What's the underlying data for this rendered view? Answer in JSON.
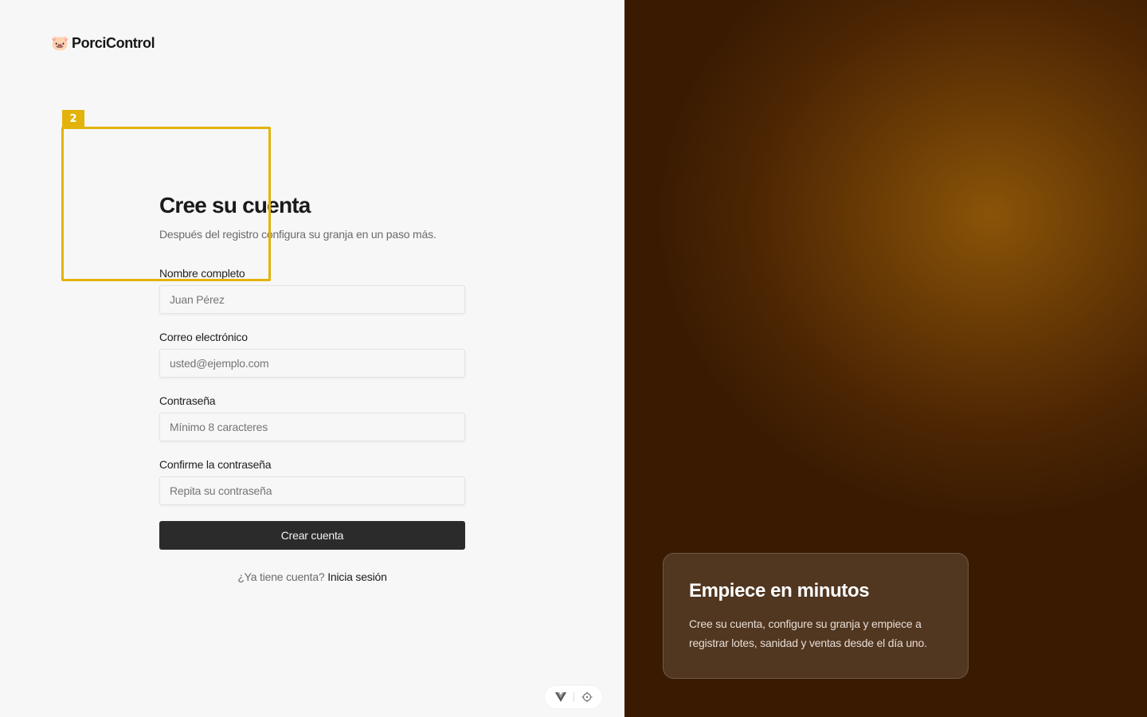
{
  "brand": {
    "icon": "pig-face-icon",
    "name": "PorciControl"
  },
  "overlay": {
    "badge_label": "2",
    "color": "#e3b30b"
  },
  "form": {
    "title": "Cree su cuenta",
    "subtitle": "Después del registro configura su granja en un paso más.",
    "fields": [
      {
        "label": "Nombre completo",
        "placeholder": "Juan Pérez",
        "type": "text"
      },
      {
        "label": "Correo electrónico",
        "placeholder": "usted@ejemplo.com",
        "type": "email"
      },
      {
        "label": "Contraseña",
        "placeholder": "Mínimo 8 caracteres",
        "type": "password"
      },
      {
        "label": "Confirme la contraseña",
        "placeholder": "Repita su contraseña",
        "type": "password"
      }
    ],
    "submit_label": "Crear cuenta",
    "switch_prompt": "¿Ya tiene cuenta?",
    "switch_link": "Inicia sesión"
  },
  "tools": {
    "left_icon": "vue-logo-icon",
    "right_icon": "crosshair-icon"
  },
  "promo": {
    "title": "Empiece en minutos",
    "text": "Cree su cuenta, configure su granja y empiece a registrar lotes, sanidad y ventas desde el día uno."
  },
  "colors": {
    "panel_dark": "#4d2603",
    "panel_glow": "#8a5408",
    "button": "#2b2b2b"
  }
}
